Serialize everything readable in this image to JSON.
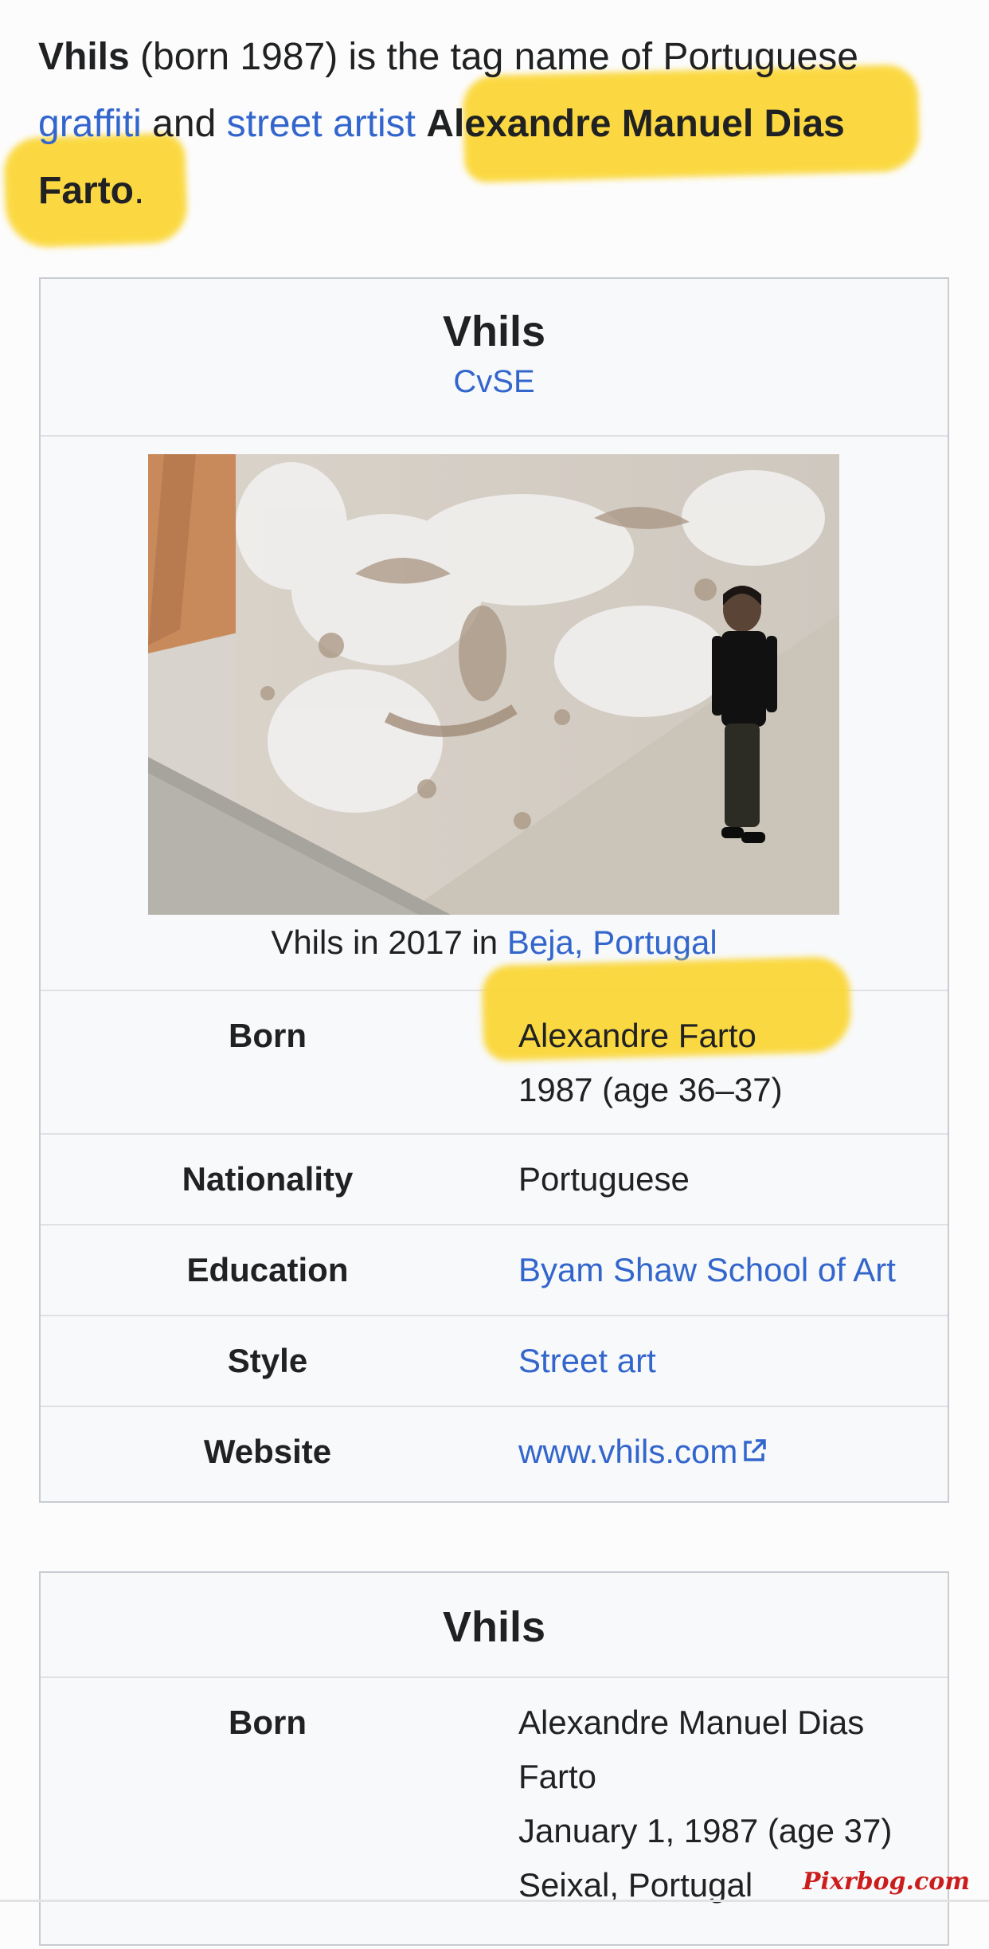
{
  "intro": {
    "subject": "Vhils",
    "text1": " (born 1987) is the tag name of Portuguese ",
    "link1": "graffiti",
    "text2": " and ",
    "link2": "street artist",
    "text3": " ",
    "fullname": "Alexandre Manuel Dias Farto",
    "text4": "."
  },
  "infobox1": {
    "title": "Vhils",
    "subtitle": "CvSE",
    "caption_text": "Vhils in 2017 in ",
    "caption_link": "Beja, Portugal",
    "rows": [
      {
        "label": "Born",
        "value_line1": "Alexandre Farto",
        "value_line2": "1987 (age 36–37)"
      },
      {
        "label": "Nationality",
        "value": "Portuguese"
      },
      {
        "label": "Education",
        "value": "Byam Shaw School of Art"
      },
      {
        "label": "Style",
        "value": "Street art"
      },
      {
        "label": "Website",
        "value": "www.vhils.com"
      }
    ]
  },
  "infobox2": {
    "title": "Vhils",
    "rows": [
      {
        "label": "Born",
        "value_line1": "Alexandre Manuel Dias",
        "value_line2": "Farto",
        "value_line3": "January 1, 1987 (age 37)",
        "value_line4": "Seixal, Portugal"
      }
    ]
  },
  "watermark": "Pixrbog.com",
  "colors": {
    "link": "#3366cc",
    "highlight": "#fbd633",
    "infobox_bg": "#f8f9fa",
    "border": "#c8ccd1"
  }
}
